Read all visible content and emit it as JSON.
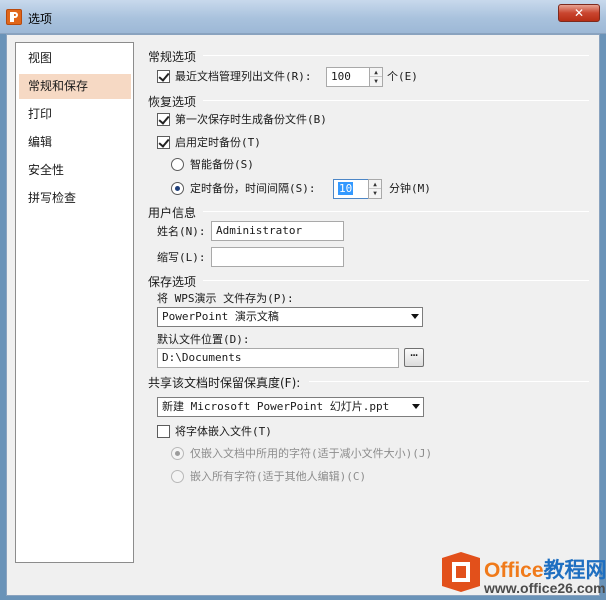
{
  "window": {
    "title": "选项",
    "close_label": "✕"
  },
  "nav": {
    "items": [
      {
        "label": "视图"
      },
      {
        "label": "常规和保存",
        "selected": true
      },
      {
        "label": "打印"
      },
      {
        "label": "编辑"
      },
      {
        "label": "安全性"
      },
      {
        "label": "拼写检查"
      }
    ]
  },
  "general": {
    "title": "常规选项",
    "recent_files": {
      "label": "最近文档管理列出文件(R):",
      "checked": true,
      "value": "100",
      "unit": "个(E)"
    }
  },
  "recovery": {
    "title": "恢复选项",
    "first_backup": {
      "label": "第一次保存时生成备份文件(B)",
      "checked": true
    },
    "timed_backup": {
      "label": "启用定时备份(T)",
      "checked": true
    },
    "smart_backup": {
      "label": "智能备份(S)",
      "selected": false
    },
    "interval_backup": {
      "label": "定时备份，时间间隔(S):",
      "selected": true,
      "value": "10",
      "unit": "分钟(M)"
    }
  },
  "user_info": {
    "title": "用户信息",
    "name_label": "姓名(N):",
    "name_value": "Administrator",
    "initials_label": "缩写(L):",
    "initials_value": ""
  },
  "save_options": {
    "title": "保存选项",
    "save_as_label": "将 WPS演示 文件存为(P):",
    "save_as_value": "PowerPoint 演示文稿",
    "default_location_label": "默认文件位置(D):",
    "default_location_value": "D:\\Documents",
    "browse_label": "⋯"
  },
  "fidelity": {
    "title": "共享该文档时保留保真度(F):",
    "document_value": "新建 Microsoft PowerPoint 幻灯片.ppt",
    "embed_fonts": {
      "label": "将字体嵌入文件(T)",
      "checked": false
    },
    "embed_used": {
      "label": "仅嵌入文档中所用的字符(适于减小文件大小)(J)",
      "selected": true,
      "disabled": true
    },
    "embed_all": {
      "label": "嵌入所有字符(适于其他人编辑)(C)",
      "selected": false,
      "disabled": true
    }
  },
  "watermark": {
    "brand_a": "Office",
    "brand_b": "教程网",
    "url": "www.office26.com"
  }
}
